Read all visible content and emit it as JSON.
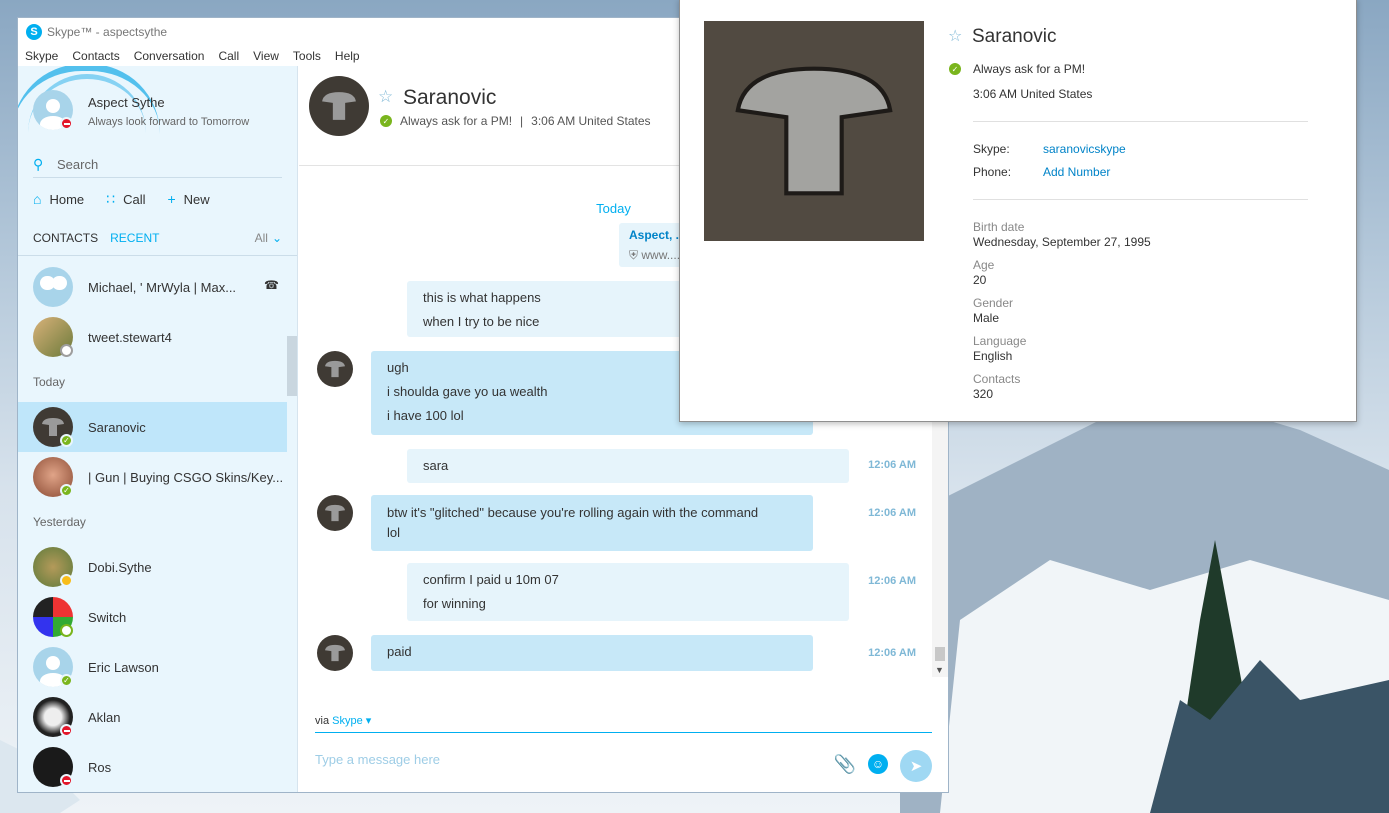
{
  "window": {
    "title": "Skype™ - aspectsythe",
    "menu": [
      "Skype",
      "Contacts",
      "Conversation",
      "Call",
      "View",
      "Tools",
      "Help"
    ]
  },
  "profile": {
    "name": "Aspect Sythe",
    "mood": "Always look forward to Tomorrow"
  },
  "search": {
    "label": "Search"
  },
  "nav": {
    "home": "Home",
    "call": "Call",
    "new": "New"
  },
  "tabs": {
    "contacts": "CONTACTS",
    "recent": "RECENT",
    "filter": "All"
  },
  "contacts": {
    "group": {
      "name": "Michael, ' MrWyla | Max..."
    },
    "tweet": {
      "name": "tweet.stewart4"
    },
    "section_today": "Today",
    "saranovic": {
      "name": "Saranovic"
    },
    "gun": {
      "name": "| Gun | Buying CSGO Skins/Key..."
    },
    "section_yesterday": "Yesterday",
    "dobi": {
      "name": "Dobi.Sythe"
    },
    "switch": {
      "name": "Switch"
    },
    "eric": {
      "name": "Eric Lawson"
    },
    "aklan": {
      "name": "Aklan"
    },
    "ros": {
      "name": "Ros"
    }
  },
  "conversation": {
    "contact_name": "Saranovic",
    "status": "Always ask for a PM!",
    "local_time": "3:06 AM United States",
    "day_label": "Today",
    "link_preview": {
      "title": "Aspect, ...",
      "url": "www...."
    },
    "messages": [
      {
        "lines": [
          "this is what happens",
          "when I try to be nice"
        ],
        "time": ""
      },
      {
        "lines": [
          "ugh",
          "i shoulda gave yo ua wealth",
          "i have 100 lol"
        ],
        "time": ""
      },
      {
        "lines": [
          "sara"
        ],
        "time": "12:06 AM"
      },
      {
        "lines": [
          "btw it's \"glitched\" because you're rolling again with the command",
          "lol"
        ],
        "time": "12:06 AM"
      },
      {
        "lines": [
          "confirm I paid u 10m 07",
          "for winning"
        ],
        "time": "12:06 AM"
      },
      {
        "lines": [
          "paid"
        ],
        "time": "12:06 AM"
      }
    ],
    "via_prefix": "via",
    "via_service": "Skype",
    "composer_placeholder": "Type a message here"
  },
  "popup": {
    "name": "Saranovic",
    "status": "Always ask for a PM!",
    "local_time": "3:06 AM United States",
    "skype_label": "Skype:",
    "skype_value": "saranovicskype",
    "phone_label": "Phone:",
    "phone_value": "Add Number",
    "birth_label": "Birth date",
    "birth_value": "Wednesday, September 27, 1995",
    "age_label": "Age",
    "age_value": "20",
    "gender_label": "Gender",
    "gender_value": "Male",
    "language_label": "Language",
    "language_value": "English",
    "contacts_label": "Contacts",
    "contacts_value": "320"
  },
  "colors": {
    "accent": "#00aff0",
    "online": "#7ab51d",
    "dnd": "#e2162a",
    "away": "#f8bd19",
    "bubble_in": "#c7e8f8",
    "bubble_out": "#e6f4fb"
  }
}
